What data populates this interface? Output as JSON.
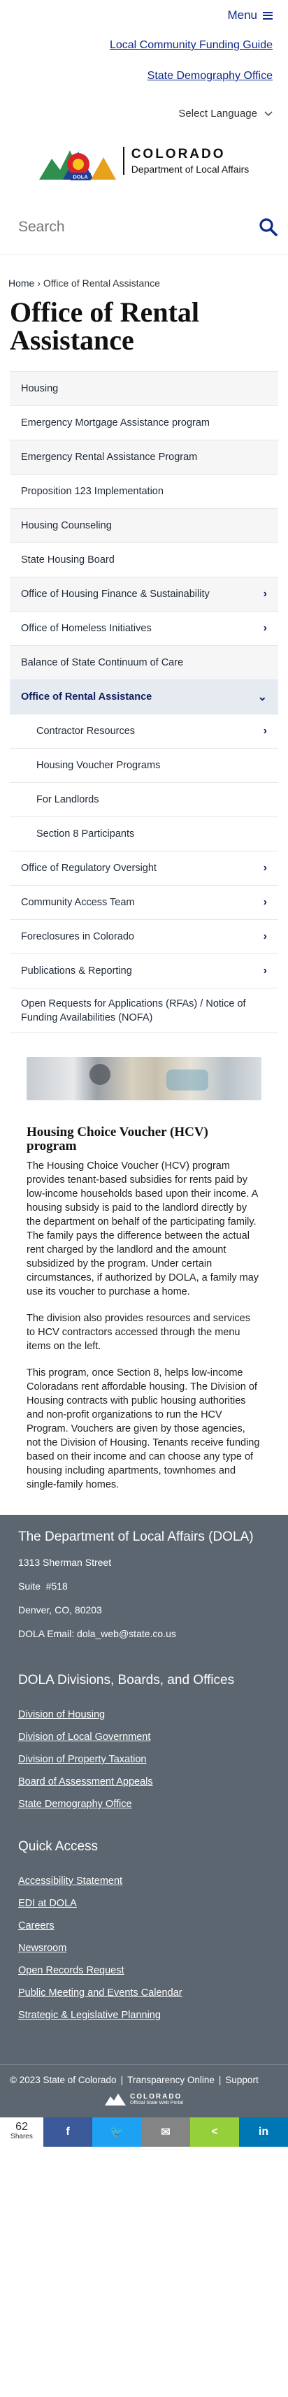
{
  "header": {
    "menu_label": "Menu",
    "util_links": [
      "Local Community Funding Guide",
      "State Demography Office"
    ],
    "language_label": "Select Language",
    "logo": {
      "state": "COLORADO",
      "department": "Department of Local Affairs",
      "badge": "DOLA"
    },
    "search_placeholder": "Search"
  },
  "breadcrumb": {
    "home": "Home",
    "separator": "›",
    "current": "Office of Rental Assistance"
  },
  "page_title": "Office of Rental Assistance",
  "sidenav": [
    {
      "label": "Housing",
      "chevron": false
    },
    {
      "label": "Emergency Mortgage Assistance program",
      "chevron": false
    },
    {
      "label": "Emergency Rental Assistance Program",
      "chevron": false
    },
    {
      "label": "Proposition 123 Implementation",
      "chevron": false
    },
    {
      "label": "Housing Counseling",
      "chevron": false
    },
    {
      "label": "State Housing Board",
      "chevron": false
    },
    {
      "label": "Office of Housing Finance & Sustainability",
      "chevron": true
    },
    {
      "label": "Office of Homeless Initiatives",
      "chevron": true
    },
    {
      "label": "Balance of State Continuum of Care",
      "chevron": false
    },
    {
      "label": "Office of Rental Assistance",
      "chevron": true,
      "active": true
    },
    {
      "label": "Contractor Resources",
      "chevron": true,
      "sub": true
    },
    {
      "label": "Housing Voucher Programs",
      "chevron": false,
      "sub": true
    },
    {
      "label": "For Landlords",
      "chevron": false,
      "sub": true
    },
    {
      "label": "Section 8 Participants",
      "chevron": false,
      "sub": true
    },
    {
      "label": "Office of Regulatory Oversight",
      "chevron": true
    },
    {
      "label": "Community Access Team",
      "chevron": true
    },
    {
      "label": "Foreclosures in Colorado",
      "chevron": true
    },
    {
      "label": "Publications & Reporting",
      "chevron": true
    },
    {
      "label": "Open Requests for Applications (RFAs) / Notice of Funding Availabilities (NOFA)",
      "chevron": false,
      "tall": true
    }
  ],
  "article": {
    "heading": "Housing Choice Voucher (HCV) program",
    "paragraphs": [
      "The Housing Choice Voucher (HCV) program provides tenant-based subsidies for rents paid by low-income households based upon their income. A housing subsidy is paid to the landlord directly by the department on behalf of the participating family. The family pays the difference between the actual rent charged by the landlord and the amount subsidized by the program. Under certain circumstances, if authorized by DOLA, a family may use its voucher to purchase a home.",
      "The division also provides resources and services to HCV contractors accessed through the menu items on the left.",
      "This program, once Section 8, helps low-income Coloradans rent affordable housing. The Division of Housing contracts with public housing authorities and non-profit organizations to run the HCV Program. Vouchers are given by those agencies, not the Division of Housing. Tenants receive funding based on their income and can choose any type of housing including apartments, townhomes and single-family homes."
    ]
  },
  "footer": {
    "org_title": "The Department of Local Affairs (DOLA)",
    "address1": "1313 Sherman Street",
    "address2": "Suite  #518",
    "address3": "Denver, CO, 80203",
    "email_label": "DOLA Email:",
    "email": "dola_web@state.co.us",
    "divisions_heading": "DOLA Divisions, Boards, and Offices",
    "divisions": [
      "Division of Housing",
      "Division of Local Government",
      "Division of Property Taxation",
      "Board of Assessment Appeals",
      "State Demography Office"
    ],
    "quick_heading": "Quick Access",
    "quick_links": [
      "Accessibility Statement",
      "EDI at DOLA",
      "Careers",
      "Newsroom",
      "Open Records Request",
      "Public Meeting and Events Calendar",
      "Strategic & Legislative Planning"
    ],
    "copyright": "© 2023 State of Colorado",
    "transparency": "Transparency Online",
    "support": "Support",
    "portal_logo": {
      "line1": "COLORADO",
      "line2": "Official State Web Portal"
    }
  },
  "share": {
    "count": "62",
    "count_label": "Shares",
    "buttons": [
      {
        "icon": "facebook-icon",
        "glyph": "f",
        "color": "#3b5998"
      },
      {
        "icon": "twitter-icon",
        "glyph": "🐦",
        "color": "#1da1f2"
      },
      {
        "icon": "email-icon",
        "glyph": "✉",
        "color": "#848484"
      },
      {
        "icon": "share-icon",
        "glyph": "<",
        "color": "#95d03a"
      },
      {
        "icon": "linkedin-icon",
        "glyph": "in",
        "color": "#0077b5"
      }
    ]
  }
}
